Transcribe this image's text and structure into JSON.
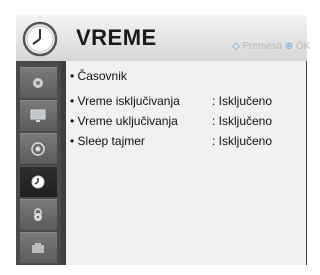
{
  "header": {
    "title": "VREME",
    "hint_move": "Premesti",
    "hint_ok": "OK",
    "icon": "clock-icon"
  },
  "sidebar": {
    "items": [
      {
        "icon": "picture-icon",
        "active": false
      },
      {
        "icon": "monitor-icon",
        "active": false
      },
      {
        "icon": "speaker-icon",
        "active": false
      },
      {
        "icon": "clock-icon",
        "active": true
      },
      {
        "icon": "lock-icon",
        "active": false
      },
      {
        "icon": "options-icon",
        "active": false
      }
    ]
  },
  "menu": {
    "items": [
      {
        "label": "• Časovnik",
        "value": ""
      },
      {
        "label": "• Vreme isključivanja",
        "value": ": Isključeno"
      },
      {
        "label": "• Vreme uključivanja",
        "value": ": Isključeno"
      },
      {
        "label": "• Sleep tajmer",
        "value": ": Isključeno"
      }
    ]
  },
  "colors": {
    "panel": "#3f3f3f",
    "content_bg": "#f1f1f1",
    "accent_blue": "#5aa6e6"
  }
}
